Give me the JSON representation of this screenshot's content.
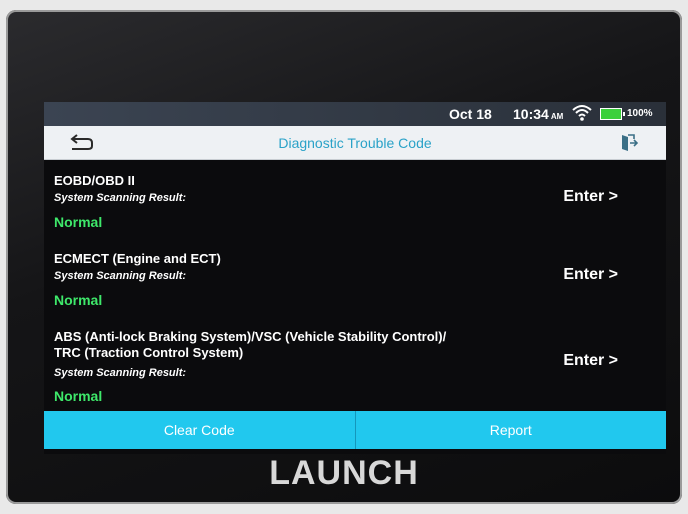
{
  "status_bar": {
    "date": "Oct 18",
    "time": "10:34",
    "ampm": "AM",
    "battery": "100%",
    "wifi_icon": "wifi-icon",
    "battery_icon": "battery-icon"
  },
  "header": {
    "title": "Diagnostic Trouble Code",
    "back_icon": "back-arrow-icon",
    "exit_icon": "exit-icon"
  },
  "systems": [
    {
      "name": "EOBD/OBD II",
      "result_label": "System Scanning Result:",
      "result": "Normal",
      "action": "Enter >"
    },
    {
      "name": "ECMECT (Engine and ECT)",
      "result_label": "System Scanning Result:",
      "result": "Normal",
      "action": "Enter >"
    },
    {
      "name_line1": "ABS (Anti-lock Braking System)/VSC (Vehicle Stability Control)/",
      "name_line2": "TRC (Traction Control System)",
      "result_label": "System Scanning Result:",
      "result": "Normal",
      "action": "Enter >"
    }
  ],
  "buttons": {
    "clear_code": "Clear Code",
    "report": "Report"
  },
  "brand": "LAUNCH",
  "colors": {
    "accent": "#21c8ee",
    "result_ok": "#3ee86a",
    "title_text": "#2aa2c8"
  }
}
